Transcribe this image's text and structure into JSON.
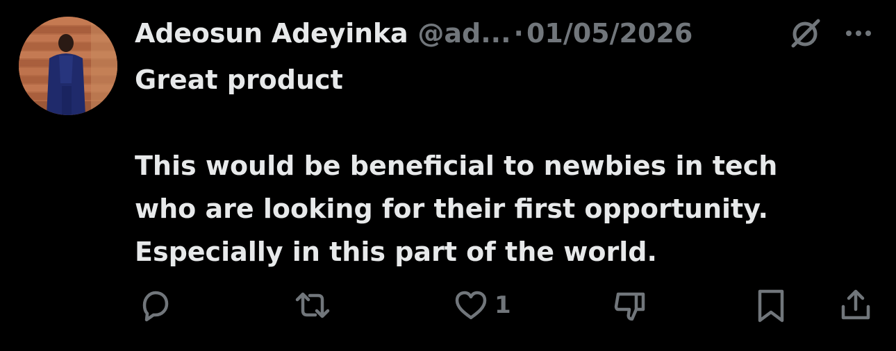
{
  "tweet": {
    "author": {
      "display_name": "Adeosun Adeyinka",
      "handle": "@ad...",
      "separator": "·",
      "date": "01/05/2026",
      "avatar_icon": "user-avatar"
    },
    "body": {
      "paragraph_1": "Great product",
      "paragraph_2_line_1": "This would be beneficial to newbies in tech",
      "paragraph_2_line_2": "who are looking for their first opportunity.",
      "paragraph_2_line_3": "Especially in this part of the world."
    },
    "actions": {
      "reply_icon": "reply-icon",
      "repost_icon": "repost-icon",
      "like_icon": "heart-icon",
      "like_count": "1",
      "downvote_icon": "thumbs-down-icon",
      "bookmark_icon": "bookmark-icon",
      "share_icon": "share-icon"
    },
    "header_icons": {
      "grok": "grok-icon",
      "more": "more-icon"
    }
  },
  "colors": {
    "background": "#000000",
    "primary_text": "#e7e9ea",
    "secondary_text": "#71767b"
  }
}
